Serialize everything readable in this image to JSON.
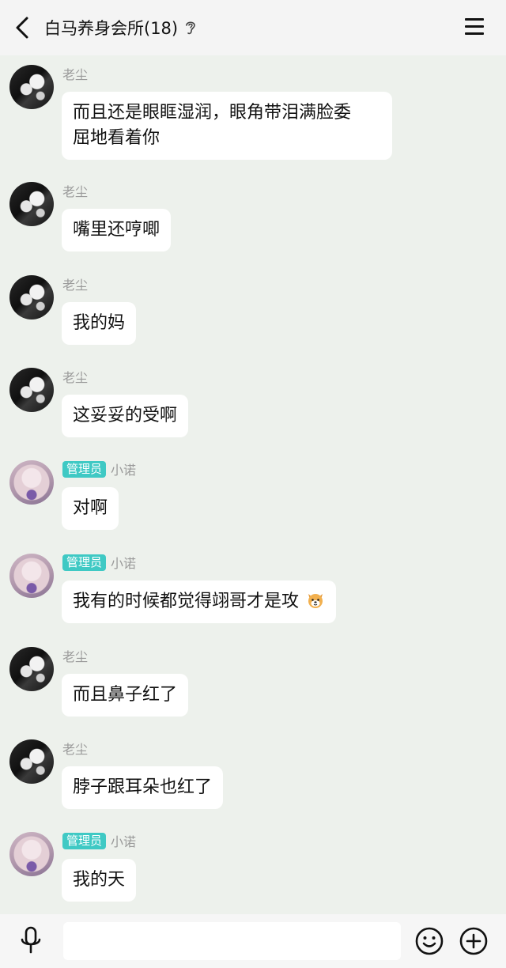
{
  "header": {
    "title": "白马养身会所(18)",
    "back_icon": "chevron-left-icon",
    "status_icon": "ear-icon",
    "menu_icon": "hamburger-menu-icon"
  },
  "colors": {
    "background": "#edf1ec",
    "header_bg": "#f4f4f4",
    "badge": "#3fc9c4",
    "bubble": "#ffffff",
    "name": "#9a9a9a"
  },
  "messages": [
    {
      "sender": "老尘",
      "badge": "",
      "text_lines": [
        "而且还是眼眶湿润，眼角带泪满脸委",
        "屈地看着你"
      ]
    },
    {
      "sender": "老尘",
      "badge": "",
      "text": "嘴里还哼唧"
    },
    {
      "sender": "老尘",
      "badge": "",
      "text": "我的妈"
    },
    {
      "sender": "老尘",
      "badge": "",
      "text": "这妥妥的受啊"
    },
    {
      "sender": "小诺",
      "badge": "管理员",
      "text": "对啊"
    },
    {
      "sender": "小诺",
      "badge": "管理员",
      "text": "我有的时候都觉得翊哥才是攻",
      "emoji": "dog-face-emoji"
    },
    {
      "sender": "老尘",
      "badge": "",
      "text": "而且鼻子红了"
    },
    {
      "sender": "老尘",
      "badge": "",
      "text": "脖子跟耳朵也红了"
    },
    {
      "sender": "小诺",
      "badge": "管理员",
      "text": "我的天"
    }
  ],
  "input_bar": {
    "voice_icon": "microphone-icon",
    "input_value": "",
    "emoji_icon": "smiley-icon",
    "plus_icon": "plus-circle-icon"
  }
}
